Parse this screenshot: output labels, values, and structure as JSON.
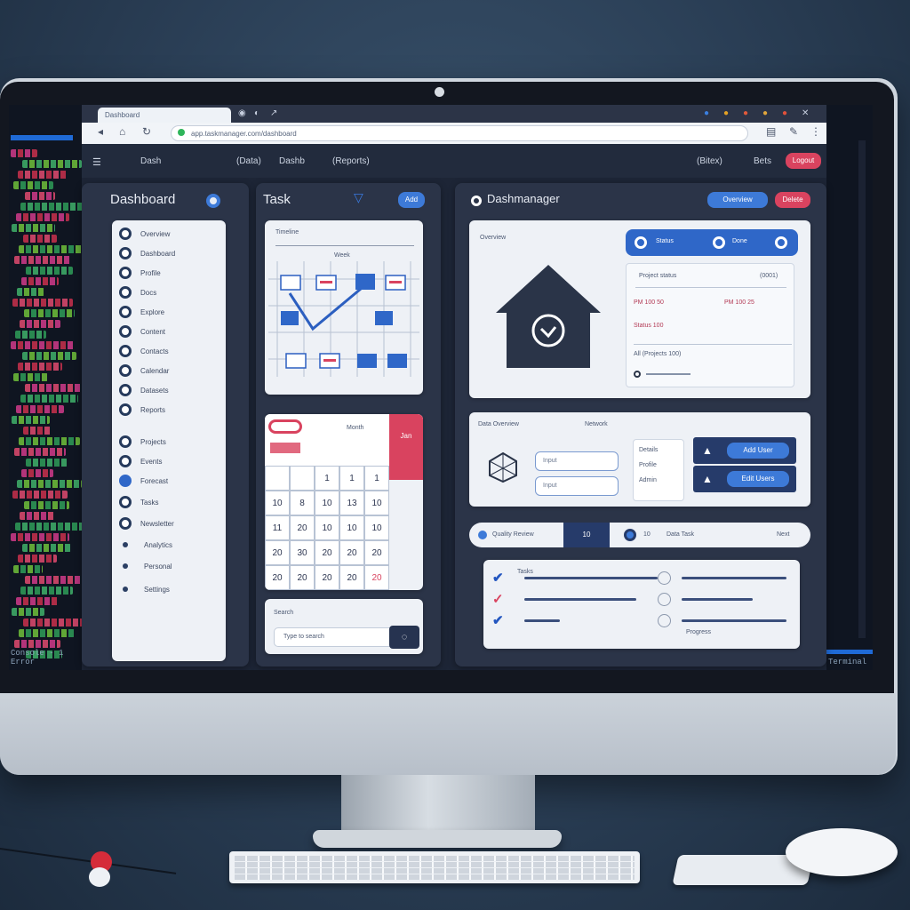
{
  "browser": {
    "tab_title": "Dashboard",
    "url": "app.taskmanager.com/dashboard",
    "nav_icons": [
      "back-icon",
      "home-icon",
      "refresh-icon"
    ]
  },
  "appbar": {
    "crumbs": [
      "Dash",
      "(Data)",
      "Dashb",
      "(Reports)"
    ],
    "right_label": "(Bitex)",
    "right_label2": "Bets",
    "action_label": "Logout"
  },
  "sidebar": {
    "title": "Dashboard",
    "items": [
      "Overview",
      "Dashboard",
      "Profile",
      "Docs",
      "Explore",
      "Content",
      "Contacts",
      "Calendar",
      "Datasets",
      "Reports",
      "Projects",
      "Events",
      "Forecast",
      "Tasks",
      "Newsletter",
      "Analytics",
      "Personal",
      "Settings"
    ]
  },
  "task": {
    "title": "Task",
    "button": "Add",
    "board_label": "Timeline",
    "board_header": "Week",
    "calendar_header": "Month",
    "calendar_badge": "Jan",
    "calendar_days": [
      "",
      "",
      "1",
      "1",
      "1",
      "10",
      "8",
      "10",
      "13",
      "10",
      "11",
      "20",
      "10",
      "10",
      "10",
      "20",
      "30",
      "20",
      "20",
      "20",
      "20",
      "20",
      "20",
      "20",
      "20"
    ],
    "search_label": "Search",
    "search_placeholder": "Type to search"
  },
  "right": {
    "title": "Dashmanager",
    "btn_primary": "Overview",
    "btn_secondary": "Delete",
    "card1_label": "Overview",
    "status_segments": [
      "Status",
      "Done"
    ],
    "info_title": "Project status",
    "info_code": "(0001)",
    "info_lines": [
      "PM 100 50",
      "PM 100 25",
      "Status 100"
    ],
    "footer_line": "All (Projects 100)",
    "card2_title": "Data Overview",
    "card2_sub": "Network",
    "inputs": [
      "Input",
      "Input"
    ],
    "mid_lines": [
      "Details",
      "Profile",
      "Admin"
    ],
    "action_rows": [
      "Add User",
      "Edit Users"
    ],
    "strip_left": "Quality Review",
    "strip_mid": "10",
    "strip_right": "Data Task",
    "strip_end": "Next",
    "tasks_label": "Tasks",
    "tasks_foot": "Progress"
  },
  "code": {
    "footer_left": "Console - 1 Error",
    "footer_right": "Terminal"
  },
  "colors": {
    "accent": "#2f67c8",
    "danger": "#d9435f",
    "panel": "#2b3448"
  }
}
